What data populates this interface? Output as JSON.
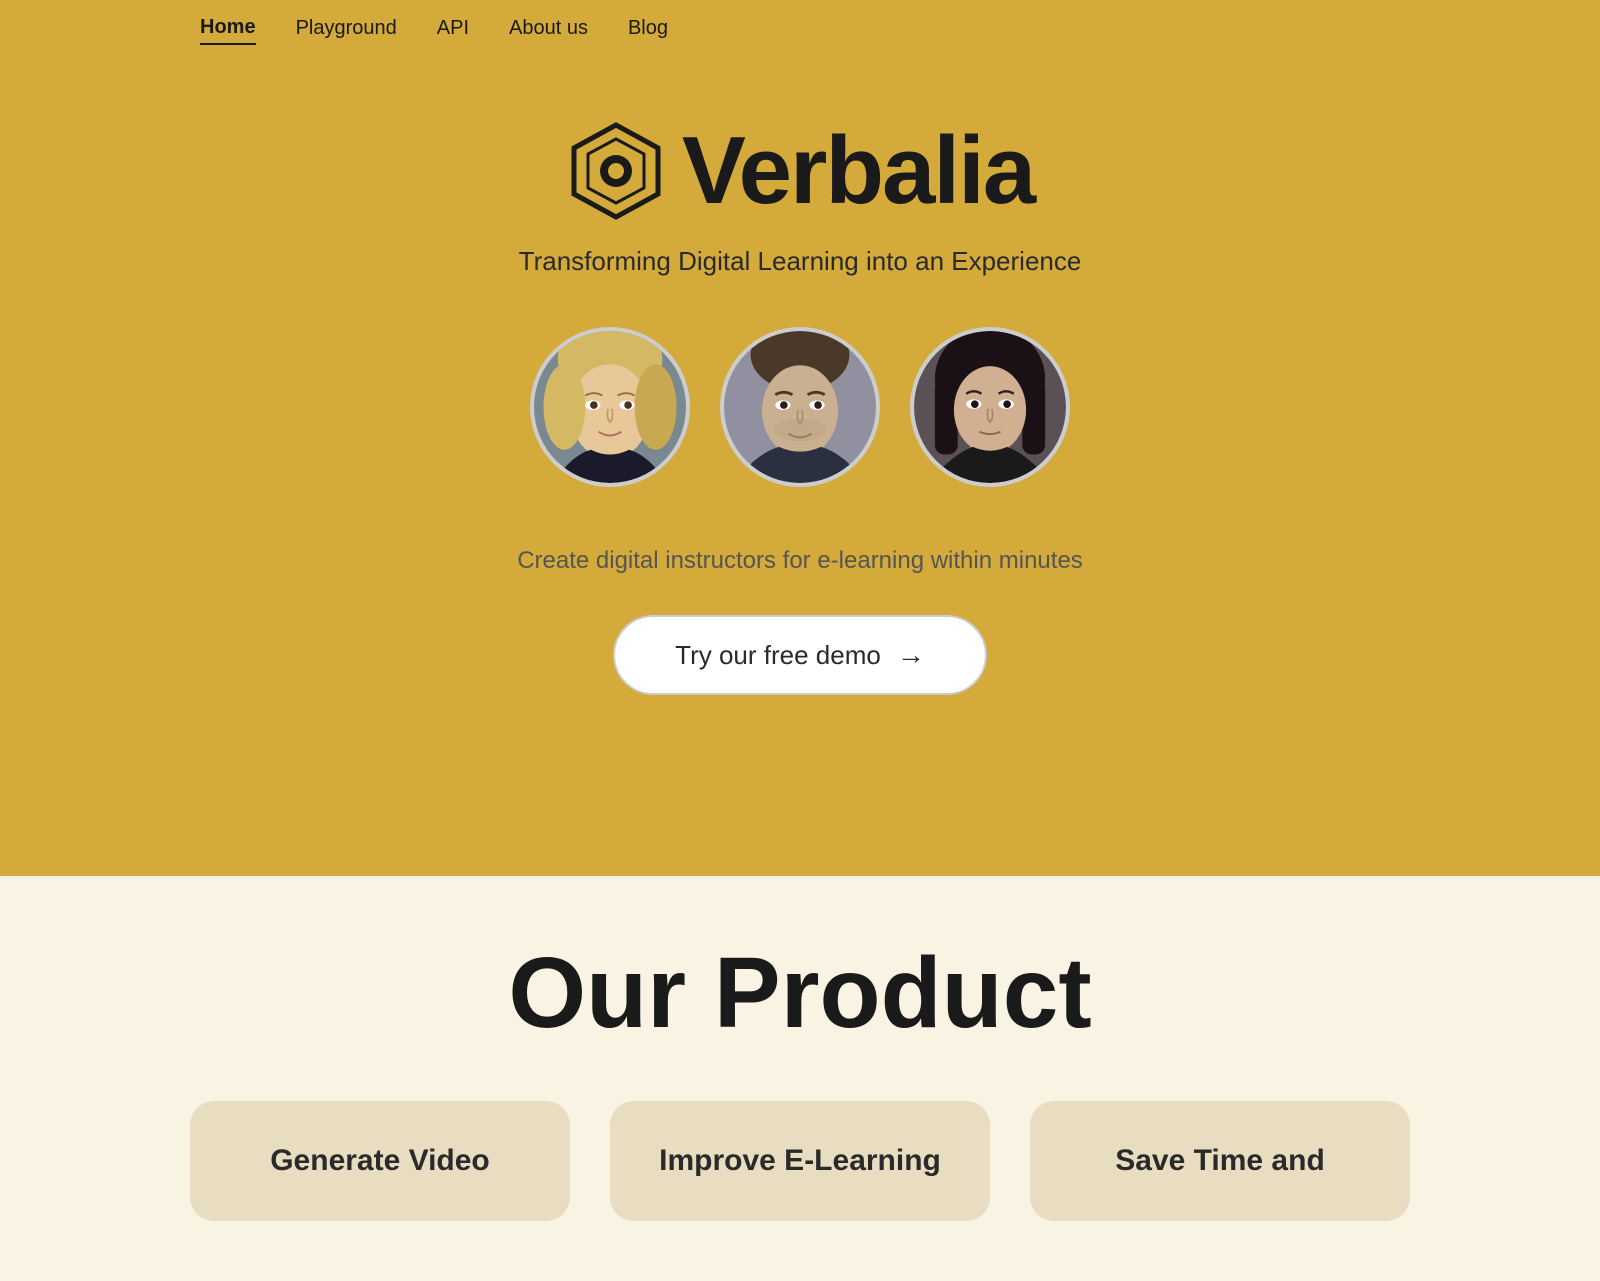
{
  "nav": {
    "items": [
      {
        "label": "Home",
        "id": "home",
        "active": true
      },
      {
        "label": "Playground",
        "id": "playground",
        "active": false
      },
      {
        "label": "API",
        "id": "api",
        "active": false
      },
      {
        "label": "About us",
        "id": "about",
        "active": false
      },
      {
        "label": "Blog",
        "id": "blog",
        "active": false
      }
    ]
  },
  "hero": {
    "logo_text": "Verbalia",
    "tagline": "Transforming Digital Learning into an Experience",
    "subtitle": "Create digital instructors for e-learning within minutes",
    "cta_label": "Try our free demo",
    "cta_arrow": "→"
  },
  "product": {
    "title": "Our Product",
    "cards": [
      {
        "label": "Generate Video"
      },
      {
        "label": "Improve E-Learning"
      },
      {
        "label": "Save Time and"
      }
    ]
  }
}
